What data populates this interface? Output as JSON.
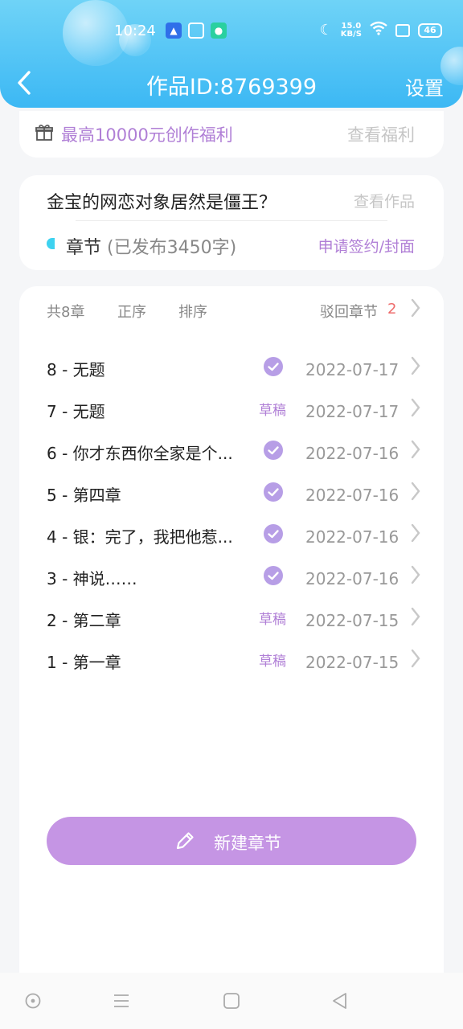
{
  "status_bar": {
    "time": "10:24",
    "speed_value": "15.0",
    "speed_unit": "KB/S",
    "battery": "46"
  },
  "header": {
    "title": "作品ID:8769399",
    "settings_label": "设置"
  },
  "welfare": {
    "text": "最高10000元创作福利",
    "link": "查看福利"
  },
  "work": {
    "title": "金宝的网恋对象居然是僵王？",
    "view_label": "查看作品",
    "chapter_label": "章节",
    "published": "(已发布3450字)",
    "apply_label": "申请签约/封面"
  },
  "filters": {
    "total": "共8章",
    "order": "正序",
    "sort": "排序",
    "rejected_label": "驳回章节",
    "rejected_count": "2"
  },
  "chapters": [
    {
      "name": "8 - 无题",
      "status": "published",
      "date": "2022-07-17"
    },
    {
      "name": "7 - 无题",
      "status": "草稿",
      "date": "2022-07-17"
    },
    {
      "name": "6 - 你才东西你全家是个...",
      "status": "published",
      "date": "2022-07-16"
    },
    {
      "name": "5 - 第四章",
      "status": "published",
      "date": "2022-07-16"
    },
    {
      "name": "4 - 银：完了，我把他惹...",
      "status": "published",
      "date": "2022-07-16"
    },
    {
      "name": "3 - 神说……",
      "status": "published",
      "date": "2022-07-16"
    },
    {
      "name": "2 - 第二章",
      "status": "草稿",
      "date": "2022-07-15"
    },
    {
      "name": "1 - 第一章",
      "status": "草稿",
      "date": "2022-07-15"
    }
  ],
  "new_chapter_label": "新建章节",
  "colors": {
    "header_start": "#6fd3f7",
    "header_end": "#3cb8f4",
    "accent_purple": "#b07fd6",
    "button_purple": "#c595e4",
    "rejected_red": "#ee6b6b"
  }
}
